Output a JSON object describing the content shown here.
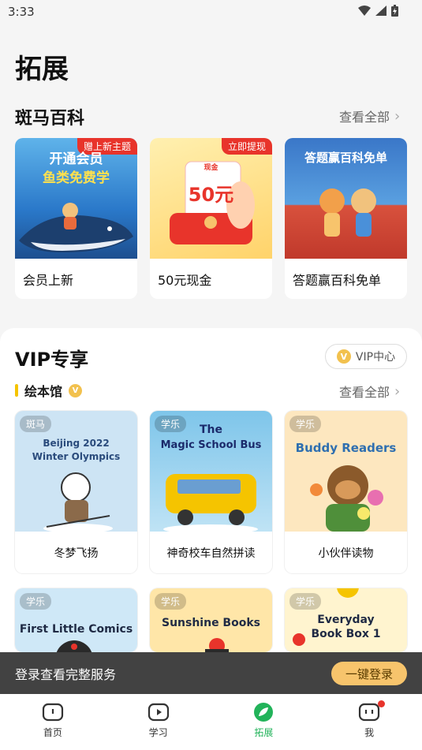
{
  "status_bar": {
    "time": "3:33"
  },
  "page": {
    "title": "拓展"
  },
  "encyclopedia": {
    "title": "斑马百科",
    "see_all": "查看全部",
    "cards": [
      {
        "label": "会员上新",
        "ribbon": "赠上新主题",
        "cover_line1": "开通会员",
        "cover_line2": "鱼类免费学",
        "bg": "#2a78c9"
      },
      {
        "label": "50元现金",
        "ribbon": "立即提现",
        "cover_line1": "现金",
        "cover_line2": "50元",
        "bg": "#ffd36a"
      },
      {
        "label": "答题赢百科免单",
        "ribbon": "",
        "cover_line1": "答题赢百科免单",
        "cover_line2": "",
        "bg": "#3a77c8"
      }
    ]
  },
  "vip": {
    "title": "VIP专享",
    "center_button": "VIP中心",
    "badge": "V",
    "subsection": {
      "title": "绘本馆",
      "see_all": "查看全部"
    },
    "books_row1": [
      {
        "tag": "斑马",
        "label": "冬梦飞扬",
        "cover_line1": "Beijing 2022",
        "cover_line2": "Winter Olympics",
        "bg": "#cde4f4",
        "text_color": "#2a4b7c"
      },
      {
        "tag": "学乐",
        "label": "神奇校车自然拼读",
        "cover_line1": "The",
        "cover_line2": "Magic School Bus",
        "bg": "#7ec5ea",
        "text_color": "#1b2a6b"
      },
      {
        "tag": "学乐",
        "label": "小伙伴读物",
        "cover_line1": "Buddy Readers",
        "cover_line2": "",
        "bg": "#fde7bf",
        "text_color": "#2f6fb0"
      }
    ],
    "books_row2": [
      {
        "tag": "学乐",
        "cover_line1": "First Little Comics",
        "bg": "#cfe8f7",
        "text_color": "#1f2a44"
      },
      {
        "tag": "学乐",
        "cover_line1": "Sunshine Books",
        "bg": "#ffe6a8",
        "text_color": "#1f2a44"
      },
      {
        "tag": "学乐",
        "cover_line1": "Everyday",
        "cover_line2": "Book Box 1",
        "bg": "#fff4cf",
        "text_color": "#1f2a44"
      }
    ]
  },
  "login_prompt": {
    "text": "登录查看完整服务",
    "button": "一键登录"
  },
  "tabs": [
    {
      "label": "首页",
      "icon": "home-icon"
    },
    {
      "label": "学习",
      "icon": "study-icon"
    },
    {
      "label": "拓展",
      "icon": "explore-leaf-icon"
    },
    {
      "label": "我",
      "icon": "me-icon"
    }
  ],
  "colors": {
    "accent_green": "#22b35a",
    "ribbon_red": "#e8342b",
    "login_btn": "#f7c46c",
    "vip_gold": "#f2c14e"
  }
}
